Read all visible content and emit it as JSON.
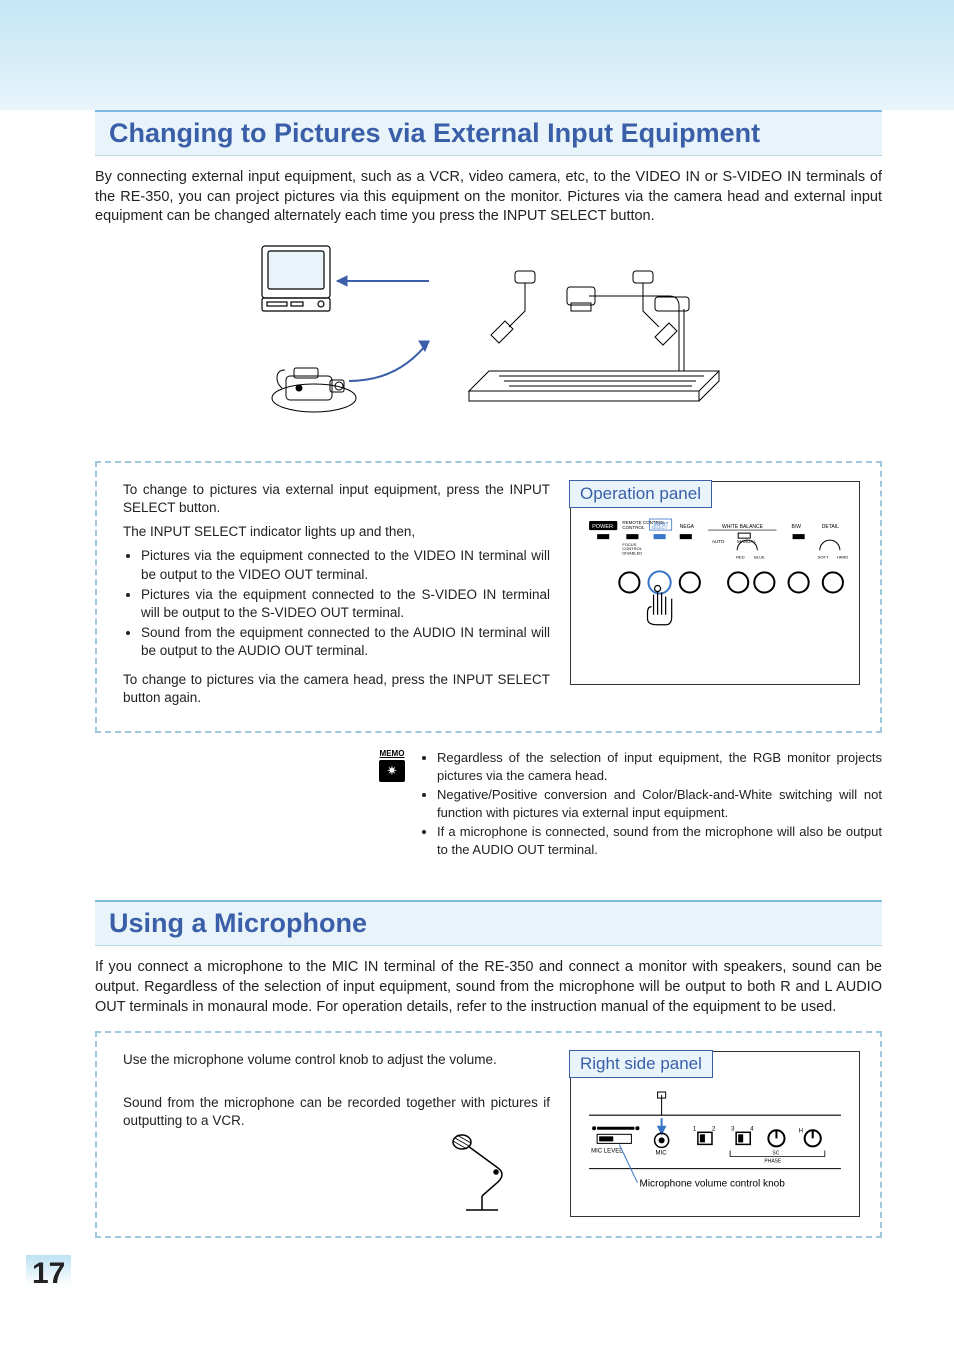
{
  "section1": {
    "title": "Changing to Pictures via External Input Equipment",
    "intro": "By connecting external input equipment, such as a VCR, video camera, etc, to the VIDEO IN or S-VIDEO IN terminals of the RE-350, you can project pictures via this equipment on the monitor. Pictures via the camera head and external input equipment can be changed alternately each time you press the INPUT SELECT button.",
    "p1": "To change to pictures via external input equipment, press the INPUT SELECT button.",
    "p2": "The INPUT SELECT indicator lights up and then,",
    "b1": "Pictures via the equipment connected to the VIDEO IN terminal will be output to the VIDEO OUT terminal.",
    "b2": "Pictures via the equipment connected to the S-VIDEO IN terminal will be output to the S-VIDEO OUT terminal.",
    "b3": "Sound from the equipment connected to the AUDIO IN terminal will be output to the AUDIO OUT terminal.",
    "p3": "To change to pictures via the camera head, press the INPUT SELECT button again.",
    "panel_label": "Operation panel",
    "op_labels": {
      "power": "POWER",
      "remote": "REMOTE\nCONTROL",
      "input": "INPUT\nSELECT",
      "nega": "NEGA",
      "focus": "FOCUS\nCONTROL\nDISABLED",
      "wb": "WHITE BALANCE",
      "auto": "AUTO",
      "manual": "MANUAL",
      "red": "RED",
      "blue": "BLUE",
      "bw": "B/W",
      "detail": "DETAIL",
      "soft": "SOFT",
      "hard": "HARD"
    }
  },
  "memo": {
    "label": "MEMO",
    "m1": "Regardless of the selection of input equipment, the RGB monitor projects pictures via the camera head.",
    "m2": "Negative/Positive conversion and Color/Black-and-White switching will not function with pictures via external input equipment.",
    "m3": "If a microphone is connected, sound from the microphone will also be output to the AUDIO OUT terminal."
  },
  "section2": {
    "title": "Using a Microphone",
    "intro": "If you connect a microphone to the MIC IN terminal of the RE-350 and connect a monitor with speakers, sound can be output. Regardless of the selection of input equipment, sound from the microphone will be output to both R and L AUDIO OUT terminals in monaural mode. For operation details, refer to the instruction manual of the equipment to be used.",
    "p1": "Use the microphone volume control knob to adjust the volume.",
    "p2": "Sound from the microphone can be recorded together with pictures if outputting to a VCR.",
    "panel_label": "Right side panel",
    "mic_level": "MIC LEVEL",
    "mic": "MIC",
    "sc": "SC",
    "phase": "PHASE",
    "h": "H",
    "n1": "1",
    "n2": "2",
    "n3": "3",
    "n4": "4",
    "pointer": "Microphone volume control knob"
  },
  "page": "17"
}
